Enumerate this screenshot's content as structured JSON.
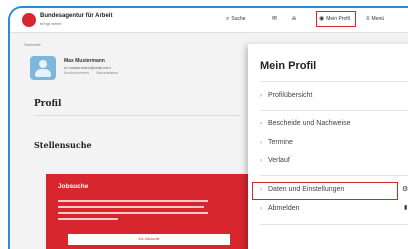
{
  "header": {
    "logo_title": "Bundesagentur für Arbeit",
    "logo_subtitle": "bringt weiter",
    "items": [
      {
        "label": "Suche",
        "icon": "search-icon"
      },
      {
        "label": "",
        "icon": "mail-icon"
      },
      {
        "label": "",
        "icon": "bell-icon"
      },
      {
        "label": "Mein Profil",
        "icon": "user-icon"
      },
      {
        "label": "Menü",
        "icon": "menu-icon"
      }
    ]
  },
  "breadcrumb": "Startseite",
  "profile": {
    "name": "Max Mustermann",
    "email": "m.mustermann@mail.com",
    "meta_left": "Kundennummer",
    "meta_right": "Geburtsdatum"
  },
  "page": {
    "title": "Profil",
    "section": "Stellensuche"
  },
  "jobcard": {
    "title": "Jobsuche",
    "button": "Zur Jobsuche"
  },
  "dropdown": {
    "title": "Mein Profil",
    "items": [
      {
        "label": "Profilübersicht"
      },
      {
        "label": "Bescheide und Nachweise"
      },
      {
        "label": "Termine"
      },
      {
        "label": "Verlauf"
      },
      {
        "label": "Daten und Einstellungen",
        "icon": "gear-icon"
      },
      {
        "label": "Abmelden",
        "icon": "logout-icon"
      }
    ]
  },
  "colors": {
    "brand": "#d7262e",
    "highlight": "#d7262e",
    "frame": "#2d8bd0"
  }
}
